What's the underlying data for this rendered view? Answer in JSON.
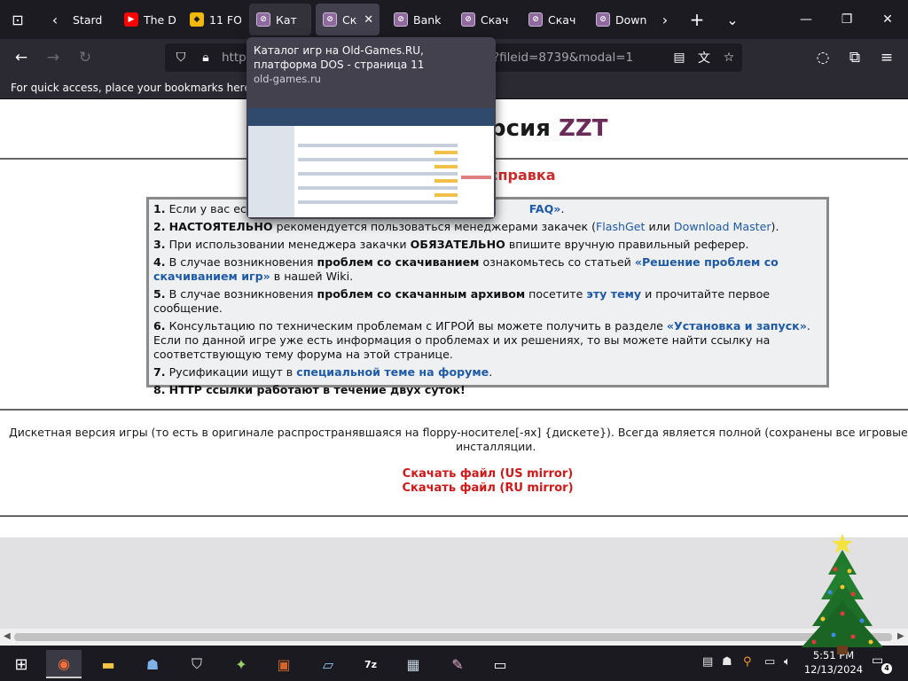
{
  "tabs": [
    {
      "label": "Stard",
      "icon": "stardew-icon",
      "active": false
    },
    {
      "label": "The D",
      "icon": "youtube-icon",
      "active": false
    },
    {
      "label": "11 FO",
      "icon": "binance-icon",
      "active": false
    },
    {
      "label": "Кат",
      "icon": "old-games-icon",
      "active": false
    },
    {
      "label": "Ск",
      "icon": "old-games-icon",
      "active": true
    },
    {
      "label": "Bank",
      "icon": "old-games-icon",
      "active": false
    },
    {
      "label": "Скач",
      "icon": "old-games-icon",
      "active": false
    },
    {
      "label": "Скач",
      "icon": "old-games-icon",
      "active": false
    },
    {
      "label": "Down",
      "icon": "old-games-icon",
      "active": false
    }
  ],
  "url": {
    "prefix": "https",
    "suffix": "?fileid=8739&modal=1"
  },
  "bookmarks_bar": {
    "text": "For quick access, place your bookmarks here on th"
  },
  "tab_preview": {
    "title": "Каталог игр на Old-Games.RU, платформа DOS - страница 11",
    "domain": "old-games.ru"
  },
  "page": {
    "version_title_prefix": "рсия ",
    "game_name": "ZZT",
    "help_title": "справка",
    "rules": {
      "r1_num": "1.",
      "r1_text": "Если у вас есть",
      "r1_link": "FAQ»",
      "r2_num": "2.",
      "r2_bold": "НАСТОЯТЕЛЬНО",
      "r2_text": "рекомендуется пользоваться менеджерами закачек (",
      "r2_link1": "FlashGet",
      "r2_or": "или",
      "r2_link2": "Download Master",
      "r2_end": ").",
      "r3_num": "3.",
      "r3_text": "При использовании менеджера закачки",
      "r3_bold": "ОБЯЗАТЕЛЬНО",
      "r3_end": "впишите вручную правильный реферер.",
      "r4_num": "4.",
      "r4_text": "В случае возникновения",
      "r4_bold": "проблем со скачиванием",
      "r4_mid": "ознакомьтесь со статьей",
      "r4_link": "«Решение проблем со скачиванием игр»",
      "r4_end": "в нашей Wiki.",
      "r5_num": "5.",
      "r5_text": "В случае возникновения",
      "r5_bold": "проблем со скачанным архивом",
      "r5_mid": "посетите",
      "r5_link": "эту тему",
      "r5_end": "и прочитайте первое сообщение.",
      "r6_num": "6.",
      "r6_text": "Консультацию по техническим проблемам с ИГРОЙ вы можете получить в разделе",
      "r6_link": "«Установка и запуск»",
      "r6_end": ". Если по данной игре уже есть информация о проблемах и их решениях, то вы можете найти ссылку на соответствующую тему форума на этой странице.",
      "r7_num": "7.",
      "r7_text": "Русификации ищут в",
      "r7_link": "специальной теме на форуме",
      "r7_end": ".",
      "r8_num": "8.",
      "r8_bold": "HTTP ссылки работают в течение двух суток!"
    },
    "description": "Дискетная версия игры (то есть в оригинале распространявшаяся на floppy-носителе[-ях] {дискете}). Всегда является полной (сохранены все игровые компоненты) и не",
    "description_line2": "инсталляции.",
    "download_us": "Скачать файл (US mirror)",
    "download_ru": "Скачать файл (RU mirror)"
  },
  "taskbar": {
    "time": "5:51 PM",
    "date": "12/13/2024",
    "notification_count": "4"
  }
}
